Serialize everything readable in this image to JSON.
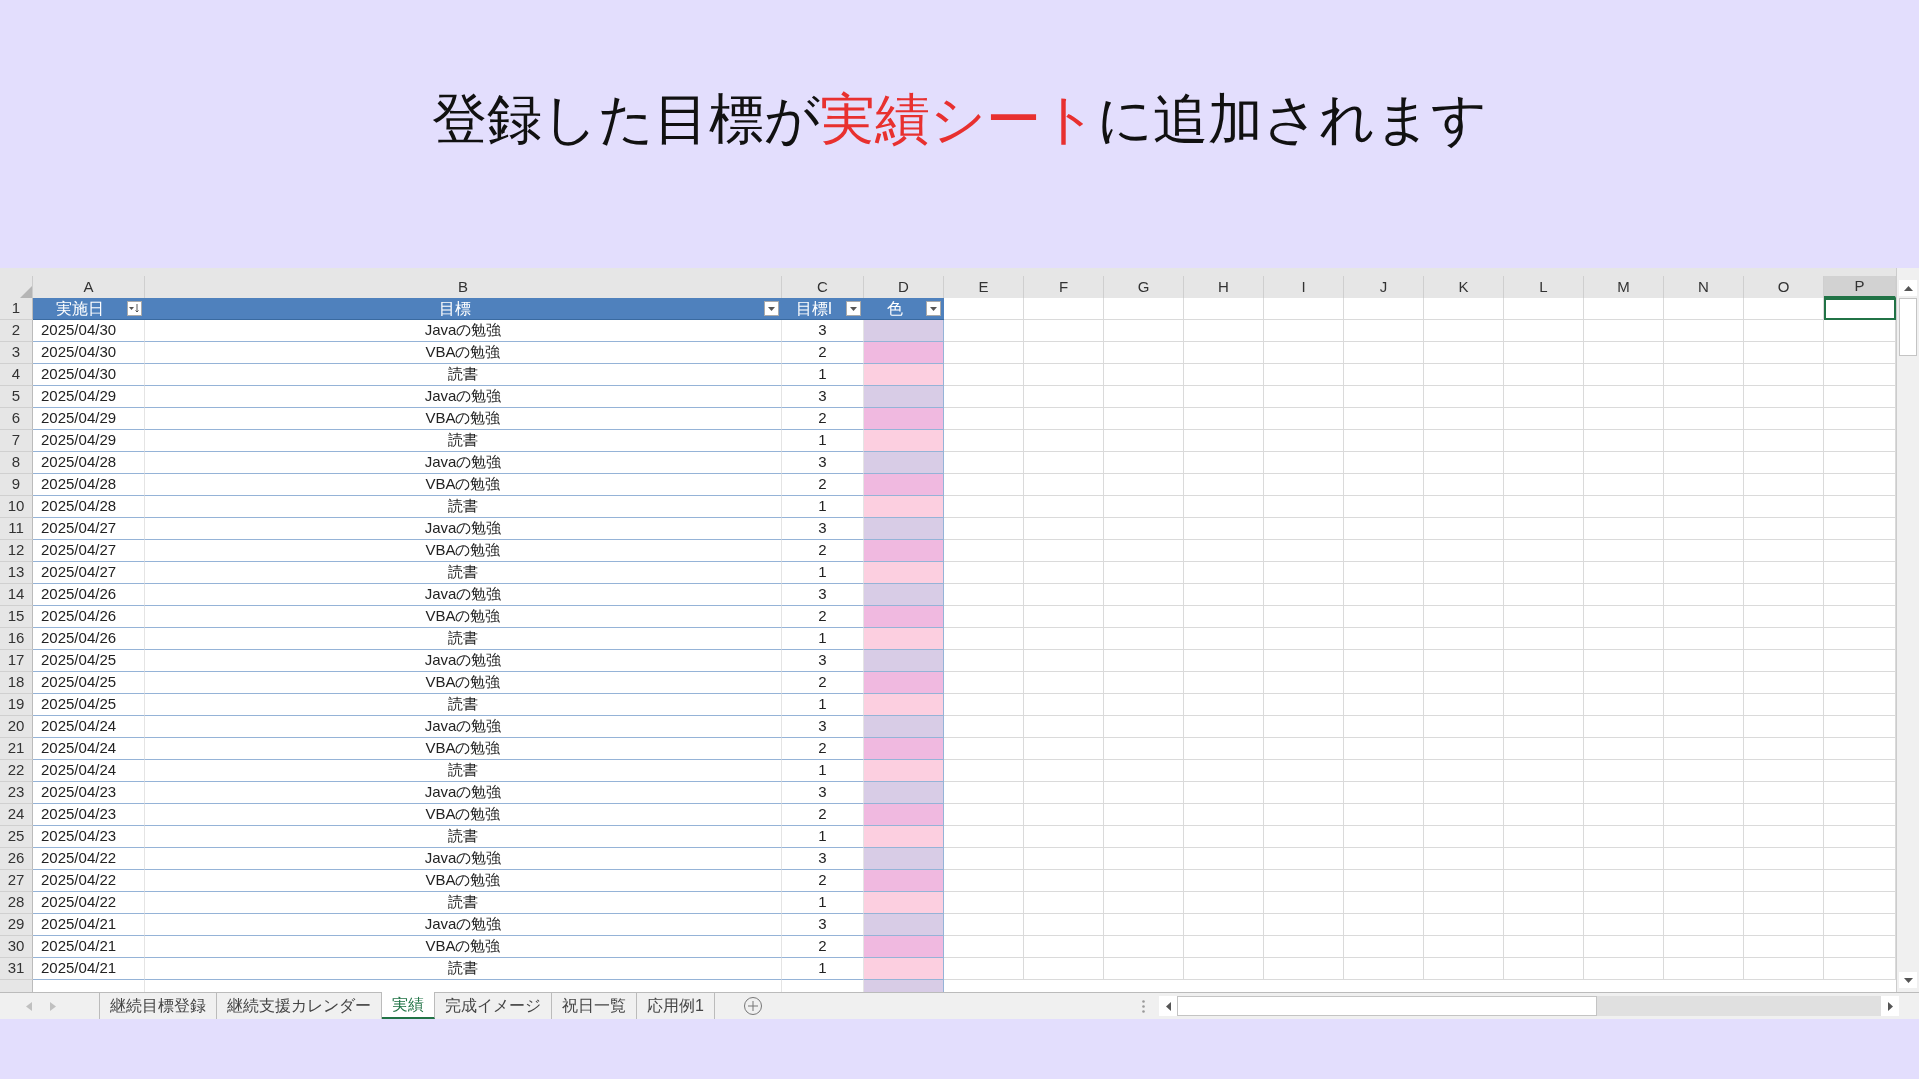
{
  "title": [
    {
      "text": "登録した目標が",
      "highlight": false
    },
    {
      "text": "実績シート",
      "highlight": true
    },
    {
      "text": "に追加されます",
      "highlight": false
    }
  ],
  "sheet": {
    "columns": [
      {
        "label": "A",
        "selected": false
      },
      {
        "label": "B",
        "selected": false
      },
      {
        "label": "C",
        "selected": false
      },
      {
        "label": "D",
        "selected": false
      },
      {
        "label": "E",
        "selected": false
      },
      {
        "label": "F",
        "selected": false
      },
      {
        "label": "G",
        "selected": false
      },
      {
        "label": "H",
        "selected": false
      },
      {
        "label": "I",
        "selected": false
      },
      {
        "label": "J",
        "selected": false
      },
      {
        "label": "K",
        "selected": false
      },
      {
        "label": "L",
        "selected": false
      },
      {
        "label": "M",
        "selected": false
      },
      {
        "label": "N",
        "selected": false
      },
      {
        "label": "O",
        "selected": false
      },
      {
        "label": "P",
        "selected": true
      }
    ],
    "header_row": {
      "number": "1",
      "cells": [
        {
          "text": "実施日",
          "kind": "sort"
        },
        {
          "text": "目標",
          "kind": "dropdown"
        },
        {
          "text": "目標I",
          "kind": "dropdown"
        },
        {
          "text": "色",
          "kind": "dropdown"
        }
      ]
    },
    "rows": [
      {
        "number": "2",
        "date": "2025/04/30",
        "goal": "Javaの勉強",
        "level": "3",
        "color": "#d8cce6"
      },
      {
        "number": "3",
        "date": "2025/04/30",
        "goal": "VBAの勉強",
        "level": "2",
        "color": "#f0b9e0"
      },
      {
        "number": "4",
        "date": "2025/04/30",
        "goal": "読書",
        "level": "1",
        "color": "#fccfe0"
      },
      {
        "number": "5",
        "date": "2025/04/29",
        "goal": "Javaの勉強",
        "level": "3",
        "color": "#d8cce6"
      },
      {
        "number": "6",
        "date": "2025/04/29",
        "goal": "VBAの勉強",
        "level": "2",
        "color": "#f0b9e0"
      },
      {
        "number": "7",
        "date": "2025/04/29",
        "goal": "読書",
        "level": "1",
        "color": "#fccfe0"
      },
      {
        "number": "8",
        "date": "2025/04/28",
        "goal": "Javaの勉強",
        "level": "3",
        "color": "#d8cce6"
      },
      {
        "number": "9",
        "date": "2025/04/28",
        "goal": "VBAの勉強",
        "level": "2",
        "color": "#f0b9e0"
      },
      {
        "number": "10",
        "date": "2025/04/28",
        "goal": "読書",
        "level": "1",
        "color": "#fccfe0"
      },
      {
        "number": "11",
        "date": "2025/04/27",
        "goal": "Javaの勉強",
        "level": "3",
        "color": "#d8cce6"
      },
      {
        "number": "12",
        "date": "2025/04/27",
        "goal": "VBAの勉強",
        "level": "2",
        "color": "#f0b9e0"
      },
      {
        "number": "13",
        "date": "2025/04/27",
        "goal": "読書",
        "level": "1",
        "color": "#fccfe0"
      },
      {
        "number": "14",
        "date": "2025/04/26",
        "goal": "Javaの勉強",
        "level": "3",
        "color": "#d8cce6"
      },
      {
        "number": "15",
        "date": "2025/04/26",
        "goal": "VBAの勉強",
        "level": "2",
        "color": "#f0b9e0"
      },
      {
        "number": "16",
        "date": "2025/04/26",
        "goal": "読書",
        "level": "1",
        "color": "#fccfe0"
      },
      {
        "number": "17",
        "date": "2025/04/25",
        "goal": "Javaの勉強",
        "level": "3",
        "color": "#d8cce6"
      },
      {
        "number": "18",
        "date": "2025/04/25",
        "goal": "VBAの勉強",
        "level": "2",
        "color": "#f0b9e0"
      },
      {
        "number": "19",
        "date": "2025/04/25",
        "goal": "読書",
        "level": "1",
        "color": "#fccfe0"
      },
      {
        "number": "20",
        "date": "2025/04/24",
        "goal": "Javaの勉強",
        "level": "3",
        "color": "#d8cce6"
      },
      {
        "number": "21",
        "date": "2025/04/24",
        "goal": "VBAの勉強",
        "level": "2",
        "color": "#f0b9e0"
      },
      {
        "number": "22",
        "date": "2025/04/24",
        "goal": "読書",
        "level": "1",
        "color": "#fccfe0"
      },
      {
        "number": "23",
        "date": "2025/04/23",
        "goal": "Javaの勉強",
        "level": "3",
        "color": "#d8cce6"
      },
      {
        "number": "24",
        "date": "2025/04/23",
        "goal": "VBAの勉強",
        "level": "2",
        "color": "#f0b9e0"
      },
      {
        "number": "25",
        "date": "2025/04/23",
        "goal": "読書",
        "level": "1",
        "color": "#fccfe0"
      },
      {
        "number": "26",
        "date": "2025/04/22",
        "goal": "Javaの勉強",
        "level": "3",
        "color": "#d8cce6"
      },
      {
        "number": "27",
        "date": "2025/04/22",
        "goal": "VBAの勉強",
        "level": "2",
        "color": "#f0b9e0"
      },
      {
        "number": "28",
        "date": "2025/04/22",
        "goal": "読書",
        "level": "1",
        "color": "#fccfe0"
      },
      {
        "number": "29",
        "date": "2025/04/21",
        "goal": "Javaの勉強",
        "level": "3",
        "color": "#d8cce6"
      },
      {
        "number": "30",
        "date": "2025/04/21",
        "goal": "VBAの勉強",
        "level": "2",
        "color": "#f0b9e0"
      },
      {
        "number": "31",
        "date": "2025/04/21",
        "goal": "読書",
        "level": "1",
        "color": "#fccfe0"
      }
    ]
  },
  "sheet_tabs": [
    {
      "label": "継続目標登録",
      "selected": false
    },
    {
      "label": "継続支援カレンダー",
      "selected": false
    },
    {
      "label": "実績",
      "selected": true
    },
    {
      "label": "完成イメージ",
      "selected": false
    },
    {
      "label": "祝日一覧",
      "selected": false
    },
    {
      "label": "応用例1",
      "selected": false
    }
  ]
}
